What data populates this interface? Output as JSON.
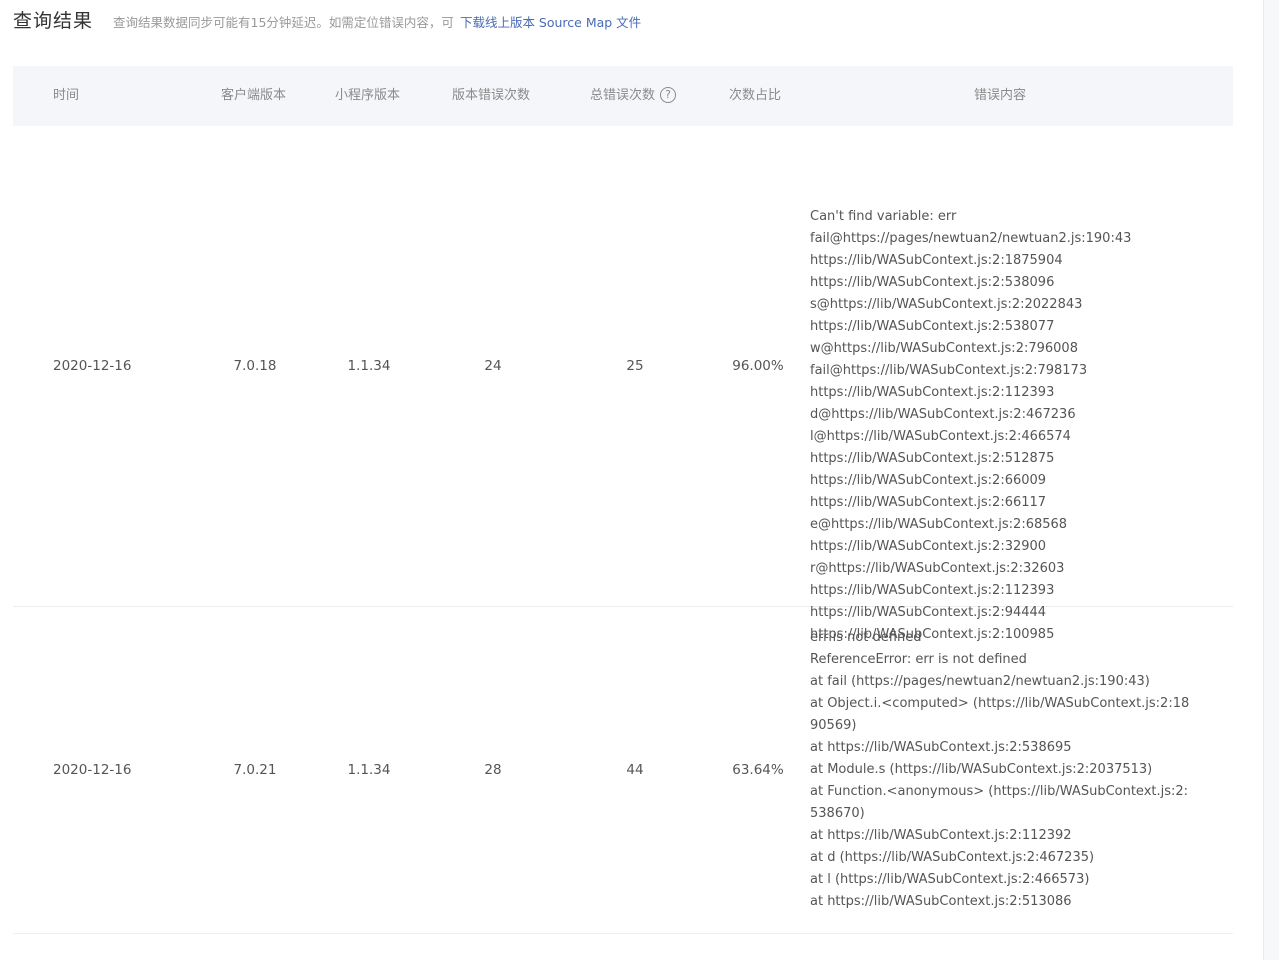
{
  "header": {
    "title": "查询结果",
    "subtitle": "查询结果数据同步可能有15分钟延迟。如需定位错误内容，可",
    "link_text": "下载线上版本 Source Map 文件"
  },
  "table": {
    "columns": {
      "time": "时间",
      "client_version": "客户端版本",
      "mini_program_version": "小程序版本",
      "version_error_count": "版本错误次数",
      "total_error_count": "总错误次数",
      "ratio": "次数占比",
      "error_content": "错误内容"
    },
    "help_icon_glyph": "?",
    "rows": [
      {
        "time": "2020-12-16",
        "client_version": "7.0.18",
        "mini_program_version": "1.1.34",
        "version_error_count": "24",
        "total_error_count": "25",
        "ratio": "96.00%",
        "error_content": "Can't find variable: err\nfail@https://pages/newtuan2/newtuan2.js:190:43\nhttps://lib/WASubContext.js:2:1875904\nhttps://lib/WASubContext.js:2:538096\ns@https://lib/WASubContext.js:2:2022843\nhttps://lib/WASubContext.js:2:538077\nw@https://lib/WASubContext.js:2:796008\nfail@https://lib/WASubContext.js:2:798173\nhttps://lib/WASubContext.js:2:112393\nd@https://lib/WASubContext.js:2:467236\nl@https://lib/WASubContext.js:2:466574\nhttps://lib/WASubContext.js:2:512875\nhttps://lib/WASubContext.js:2:66009\nhttps://lib/WASubContext.js:2:66117\ne@https://lib/WASubContext.js:2:68568\nhttps://lib/WASubContext.js:2:32900\nr@https://lib/WASubContext.js:2:32603\nhttps://lib/WASubContext.js:2:112393\nhttps://lib/WASubContext.js:2:94444\nhttps://lib/WASubContext.js:2:100985"
      },
      {
        "time": "2020-12-16",
        "client_version": "7.0.21",
        "mini_program_version": "1.1.34",
        "version_error_count": "28",
        "total_error_count": "44",
        "ratio": "63.64%",
        "error_content": "err is not defined\nReferenceError: err is not defined\nat fail (https://pages/newtuan2/newtuan2.js:190:43)\nat Object.i.<computed> (https://lib/WASubContext.js:2:1890569)\nat https://lib/WASubContext.js:2:538695\nat Module.s (https://lib/WASubContext.js:2:2037513)\nat Function.<anonymous> (https://lib/WASubContext.js:2:538670)\nat https://lib/WASubContext.js:2:112392\nat d (https://lib/WASubContext.js:2:467235)\nat l (https://lib/WASubContext.js:2:466573)\nat https://lib/WASubContext.js:2:513086"
      }
    ]
  }
}
